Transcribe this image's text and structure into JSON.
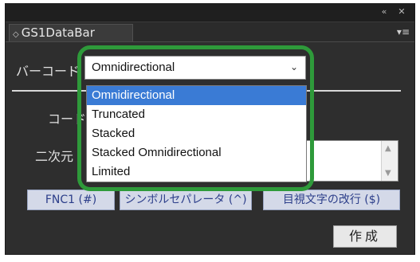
{
  "window": {
    "collapse_icon": "double-left-arrow-icon",
    "close_icon": "close-icon",
    "collapse_glyph": "«",
    "close_glyph": "✕"
  },
  "tab": {
    "label": "GS1DataBar",
    "menu_icon": "panel-menu-icon"
  },
  "barcode": {
    "label": "バーコード",
    "selected": "Omnidirectional",
    "options": [
      "Omnidirectional",
      "Truncated",
      "Stacked",
      "Stacked Omnidirectional",
      "Limited"
    ],
    "selected_index": 0
  },
  "code_label": "コード",
  "twod_label": "二次元",
  "buttons": {
    "fnc1": "FNC1 (#)",
    "symbol_sep": "シンボルセパレータ (^)",
    "visual_break": "目視文字の改行 ($)",
    "create": "作成"
  },
  "colors": {
    "highlight": "#2e9a3a",
    "selection": "#3a7bd5",
    "button_text": "#2c3e8a"
  }
}
